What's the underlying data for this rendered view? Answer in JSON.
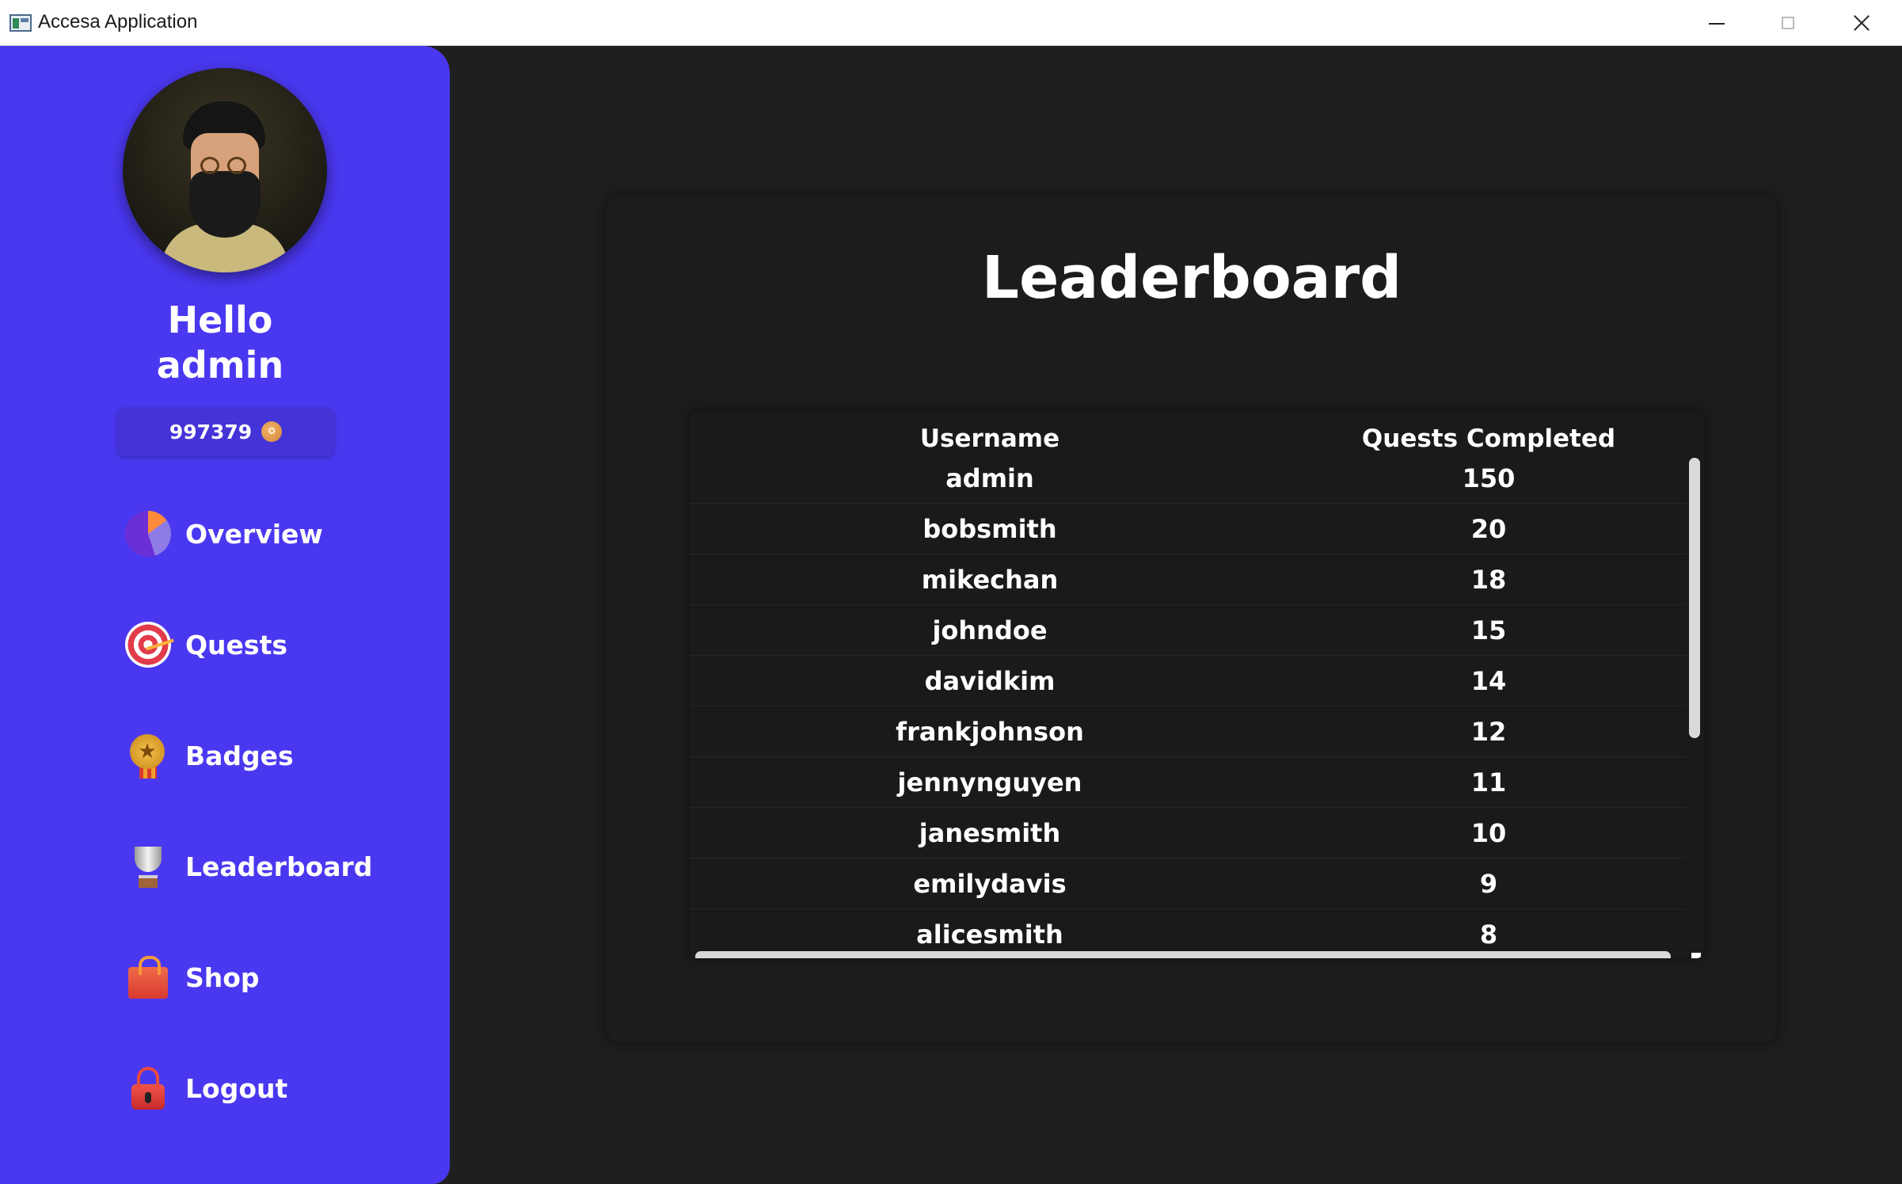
{
  "window": {
    "title": "Accesa Application"
  },
  "sidebar": {
    "greeting_line1": "Hello",
    "greeting_line2": "admin",
    "balance": "997379",
    "balance_icon": "coin-icon",
    "nav": [
      {
        "label": "Overview",
        "icon": "pie-chart-icon"
      },
      {
        "label": "Quests",
        "icon": "target-icon"
      },
      {
        "label": "Badges",
        "icon": "medal-icon"
      },
      {
        "label": "Leaderboard",
        "icon": "trophy-icon"
      },
      {
        "label": "Shop",
        "icon": "shopping-bag-icon"
      },
      {
        "label": "Logout",
        "icon": "lock-icon"
      }
    ]
  },
  "main": {
    "title": "Leaderboard",
    "table": {
      "columns": [
        "Username",
        "Quests Completed"
      ],
      "rows": [
        {
          "username": "admin",
          "quests": "150"
        },
        {
          "username": "bobsmith",
          "quests": "20"
        },
        {
          "username": "mikechan",
          "quests": "18"
        },
        {
          "username": "johndoe",
          "quests": "15"
        },
        {
          "username": "davidkim",
          "quests": "14"
        },
        {
          "username": "frankjohnson",
          "quests": "12"
        },
        {
          "username": "jennynguyen",
          "quests": "11"
        },
        {
          "username": "janesmith",
          "quests": "10"
        },
        {
          "username": "emilydavis",
          "quests": "9"
        },
        {
          "username": "alicesmith",
          "quests": "8"
        }
      ]
    }
  },
  "colors": {
    "sidebar_bg": "#4a38f0",
    "app_bg": "#1f1f1f",
    "card_bg": "#1c1c1c",
    "text": "#ffffff"
  }
}
